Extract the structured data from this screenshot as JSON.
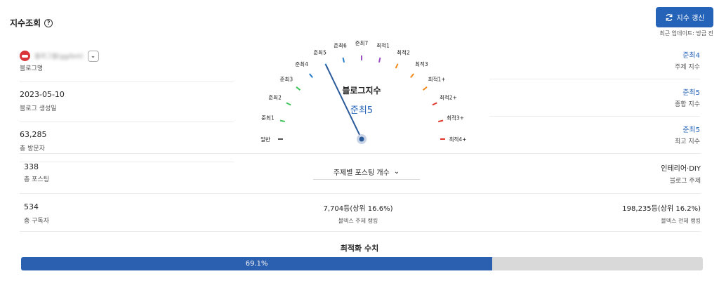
{
  "header": {
    "title": "지수조회",
    "help_icon": "question-circle-icon"
  },
  "refresh": {
    "label": "지수 갱신",
    "icon": "refresh-icon",
    "updated_text": "최근 업데이트: 방금 전"
  },
  "blog": {
    "name_blurred": "블라그블(gg/bnt)",
    "name_label": "블로그명"
  },
  "left_stats": [
    {
      "value": "2023-05-10",
      "label": "블로그 생성일"
    },
    {
      "value": "63,285",
      "label": "총 방문자"
    },
    {
      "value": "338",
      "label": "총 포스팅"
    },
    {
      "value": "534",
      "label": "총 구독자"
    }
  ],
  "right_stats": [
    {
      "value": "준최4",
      "label": "주제 지수"
    },
    {
      "value": "준최5",
      "label": "종합 지수"
    },
    {
      "value": "준최5",
      "label": "최고 지수"
    }
  ],
  "topic": {
    "value": "인테리어·DIY",
    "label": "블로그 주제"
  },
  "gauge": {
    "title": "블로그지수",
    "grade": "준최5",
    "needle_index": 5,
    "levels": [
      {
        "label": "일반",
        "color": "#555555"
      },
      {
        "label": "준최1",
        "color": "#3ec45a"
      },
      {
        "label": "준최2",
        "color": "#3ec45a"
      },
      {
        "label": "준최3",
        "color": "#3ec45a"
      },
      {
        "label": "준최4",
        "color": "#2a7ec9"
      },
      {
        "label": "준최5",
        "color": "#2a7ec9"
      },
      {
        "label": "준최6",
        "color": "#2a7ec9"
      },
      {
        "label": "준최7",
        "color": "#9b4fc4"
      },
      {
        "label": "최적1",
        "color": "#9b4fc4"
      },
      {
        "label": "최적2",
        "color": "#f08a1c"
      },
      {
        "label": "최적3",
        "color": "#f08a1c"
      },
      {
        "label": "최적1+",
        "color": "#f08a1c"
      },
      {
        "label": "최적2+",
        "color": "#e0352b"
      },
      {
        "label": "최적3+",
        "color": "#e0352b"
      },
      {
        "label": "최적4+",
        "color": "#e0352b"
      }
    ]
  },
  "posting_dropdown": {
    "label": "주제별 포스팅 개수"
  },
  "ranks": {
    "topic_value": "7,704등(상위 16.6%)",
    "topic_label": "블덱스 주제 랭킹",
    "total_value": "198,235등(상위 16.2%)",
    "total_label": "블덱스 전체 랭킹"
  },
  "optimization": {
    "title": "최적화 수치",
    "percent": 69.1,
    "percent_label": "69.1%"
  }
}
